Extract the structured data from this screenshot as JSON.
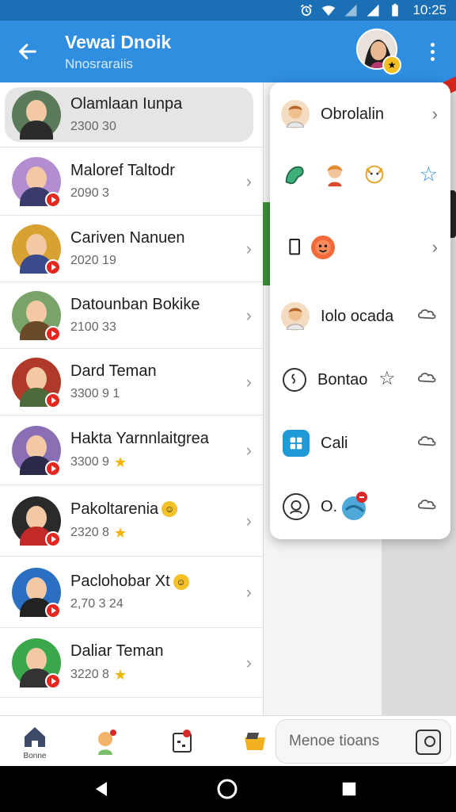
{
  "status_bar": {
    "time": "10:25",
    "icons": [
      "alarm-icon",
      "wifi-icon",
      "signal-icon",
      "battery-icon"
    ]
  },
  "app_bar": {
    "title": "Vewai Dnoik",
    "subtitle": "Nnosraraiis",
    "back_icon": "arrow-left-icon",
    "more_icon": "more-vertical-icon"
  },
  "contacts": [
    {
      "name": "Olamlaan Iunpa",
      "sub": "2300 30",
      "star": false,
      "emoji": false,
      "avatar_color": "#5a7a5a",
      "shirt": "#2b2b2b",
      "badge": false
    },
    {
      "name": "Maloref Taltodr",
      "sub": "2090 3",
      "star": false,
      "emoji": false,
      "avatar_color": "#b28ed1",
      "shirt": "#3a3a6b",
      "badge": true
    },
    {
      "name": "Cariven Nanuen",
      "sub": "2020 19",
      "star": false,
      "emoji": false,
      "avatar_color": "#d8a233",
      "shirt": "#3b4a8a",
      "badge": true
    },
    {
      "name": "Datounban Bokike",
      "sub": "2100 33",
      "star": false,
      "emoji": false,
      "avatar_color": "#7aa36a",
      "shirt": "#6b4a2a",
      "badge": true
    },
    {
      "name": "Dard Teman",
      "sub": "3300 9 1",
      "star": false,
      "emoji": false,
      "avatar_color": "#b03a2a",
      "shirt": "#4d6b3a",
      "badge": true
    },
    {
      "name": "Hakta Yarnnlaitgrea",
      "sub": "3300 9",
      "star": true,
      "emoji": false,
      "avatar_color": "#8a6fb5",
      "shirt": "#2a2a4a",
      "badge": true
    },
    {
      "name": "Pakoltarenia",
      "sub": "2320 8",
      "star": true,
      "emoji": true,
      "avatar_color": "#2a2a2a",
      "shirt": "#c22a2a",
      "badge": true
    },
    {
      "name": "Paclohobar Xt",
      "sub": "2,70 3 24",
      "star": false,
      "emoji": true,
      "avatar_color": "#2a6fc2",
      "shirt": "#222",
      "badge": true
    },
    {
      "name": "Daliar Teman",
      "sub": "3220 8",
      "star": true,
      "emoji": false,
      "avatar_color": "#3aa84a",
      "shirt": "#333",
      "badge": true
    }
  ],
  "menu": {
    "items": [
      {
        "label": "Obrolalin",
        "icon": "avatar-boy-icon",
        "trail": "chevron-right-icon"
      },
      {
        "label": "",
        "icon": "sticker-pack-icon",
        "trail": "star-outline-icon"
      },
      {
        "label": "",
        "icon": "sticker-face-icon",
        "trail": "chevron-right-icon"
      },
      {
        "label": "Iolo ocada",
        "icon": "avatar-boy-icon",
        "trail": "cloud-icon"
      },
      {
        "label": "Bontao",
        "icon": "info-circle-icon",
        "trail": "cloud-icon"
      },
      {
        "label": "Cali",
        "icon": "grid-icon",
        "trail": "cloud-icon"
      },
      {
        "label": "O.",
        "icon": "search-face-icon",
        "trail": "cloud-icon"
      }
    ]
  },
  "bottom_nav": {
    "home_label": "Bonne",
    "items": [
      "home-icon",
      "avatar-sticker-icon",
      "calendar-icon",
      "folder-icon"
    ],
    "search_placeholder": "Menoe tioans"
  },
  "system_nav": {
    "icons": [
      "back-triangle-icon",
      "home-circle-icon",
      "recents-square-icon"
    ]
  }
}
